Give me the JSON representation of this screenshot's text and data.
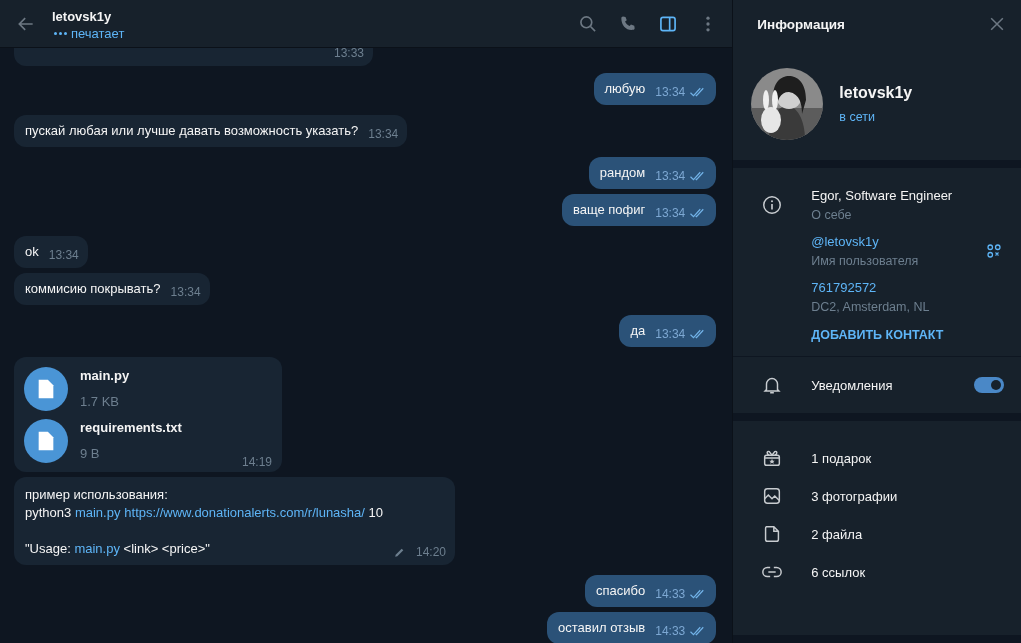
{
  "chat_header": {
    "title": "letovsk1y",
    "status": "печатает",
    "typing": true
  },
  "messages": [
    {
      "outgoing": false,
      "kind": "text",
      "time": "13:33"
    },
    {
      "outgoing": true,
      "kind": "text",
      "lines": [
        [
          {
            "text": "любую"
          }
        ]
      ],
      "time": "13:34",
      "read": true
    },
    {
      "outgoing": false,
      "kind": "text",
      "lines": [
        [
          {
            "text": "пускай любая или лучше давать возможность указать?"
          }
        ]
      ],
      "time": "13:34"
    },
    {
      "outgoing": true,
      "kind": "text",
      "lines": [
        [
          {
            "text": "рандом"
          }
        ]
      ],
      "time": "13:34",
      "read": true
    },
    {
      "outgoing": true,
      "kind": "text",
      "lines": [
        [
          {
            "text": "ваще пофиг"
          }
        ]
      ],
      "time": "13:34",
      "read": true
    },
    {
      "outgoing": false,
      "kind": "text",
      "lines": [
        [
          {
            "text": "ok"
          }
        ]
      ],
      "time": "13:34"
    },
    {
      "outgoing": false,
      "kind": "text",
      "lines": [
        [
          {
            "text": "коммисию покрывать?"
          }
        ]
      ],
      "time": "13:34"
    },
    {
      "outgoing": true,
      "kind": "text",
      "lines": [
        [
          {
            "text": "да"
          }
        ]
      ],
      "time": "13:34",
      "read": true
    },
    {
      "outgoing": false,
      "kind": "files",
      "files": [
        {
          "name": "main.py",
          "size": "1.7 KB"
        },
        {
          "name": "requirements.txt",
          "size": "9 B"
        }
      ],
      "time": "14:19"
    },
    {
      "outgoing": false,
      "kind": "text",
      "lines": [
        [
          {
            "text": "пример использования:"
          }
        ],
        [
          {
            "text": "python3 "
          },
          {
            "text": "main.py",
            "link": true
          },
          {
            "text": "https://www.donationalerts.com/r/lunasha/",
            "link": true,
            "space_before": true
          },
          {
            "text": " 10"
          }
        ],
        [
          {
            "text": "\"Usage: ",
            "blank_before": true
          },
          {
            "text": "main.py",
            "link": true
          },
          {
            "text": " <link> <price>\""
          }
        ]
      ],
      "time": "14:20",
      "edited": true
    },
    {
      "outgoing": true,
      "kind": "text",
      "lines": [
        [
          {
            "text": "спасибо"
          }
        ]
      ],
      "time": "14:33",
      "read": true
    },
    {
      "outgoing": true,
      "kind": "text",
      "lines": [
        [
          {
            "text": "оставил отзыв"
          }
        ]
      ],
      "time": "14:33",
      "read": true
    }
  ],
  "info_panel": {
    "title": "Информация",
    "profile": {
      "name": "letovsk1y",
      "status": "в сети"
    },
    "details": [
      {
        "kind": "bio",
        "value": "Egor, Software Engineer",
        "label": "О себе"
      },
      {
        "kind": "username",
        "value": "@letovsk1y",
        "label": "Имя пользователя"
      },
      {
        "kind": "id",
        "value": "761792572",
        "label": "DC2, Amsterdam, NL"
      }
    ],
    "add_contact": "ДОБАВИТЬ КОНТАКТ",
    "notifications": {
      "label": "Уведомления",
      "on": true
    },
    "media": [
      {
        "kind": "gift",
        "label": "1 подарок"
      },
      {
        "label": "3 фотографии"
      },
      {
        "kind": "file",
        "label": "2 файла"
      },
      {
        "kind": "link",
        "label": "6 ссылок"
      }
    ]
  }
}
